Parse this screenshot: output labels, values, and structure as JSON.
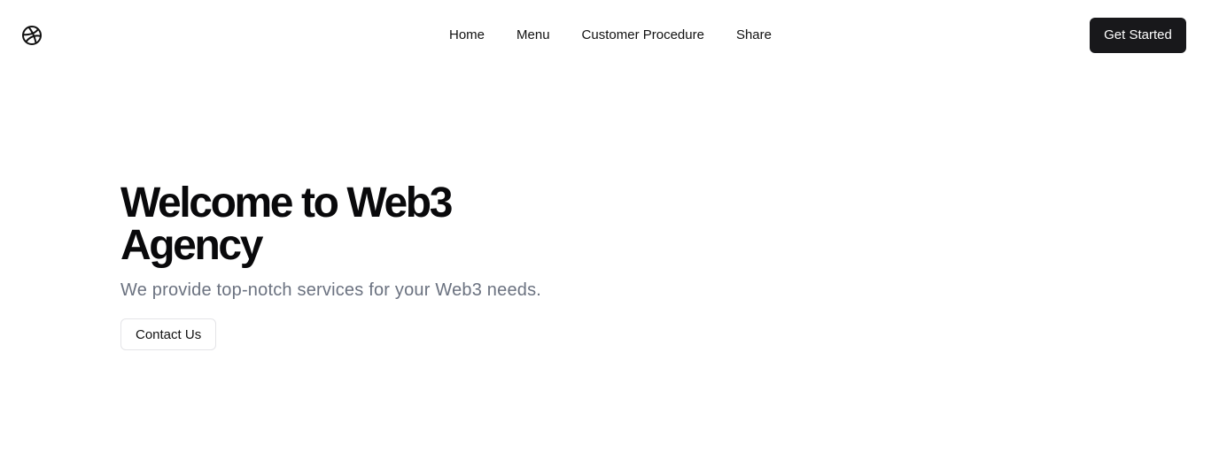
{
  "header": {
    "logo_icon": "dribbble-ball-icon",
    "nav": [
      {
        "label": "Home"
      },
      {
        "label": "Menu"
      },
      {
        "label": "Customer Procedure"
      },
      {
        "label": "Share"
      }
    ],
    "cta_label": "Get Started"
  },
  "hero": {
    "title": "Welcome to Web3 Agency",
    "subtitle": "We provide top-notch services for your Web3 needs.",
    "button_label": "Contact Us"
  },
  "colors": {
    "background": "#ffffff",
    "primary_button": "#18181b",
    "subtitle_text": "#6b7280",
    "outline_border": "#e4e4e7"
  }
}
